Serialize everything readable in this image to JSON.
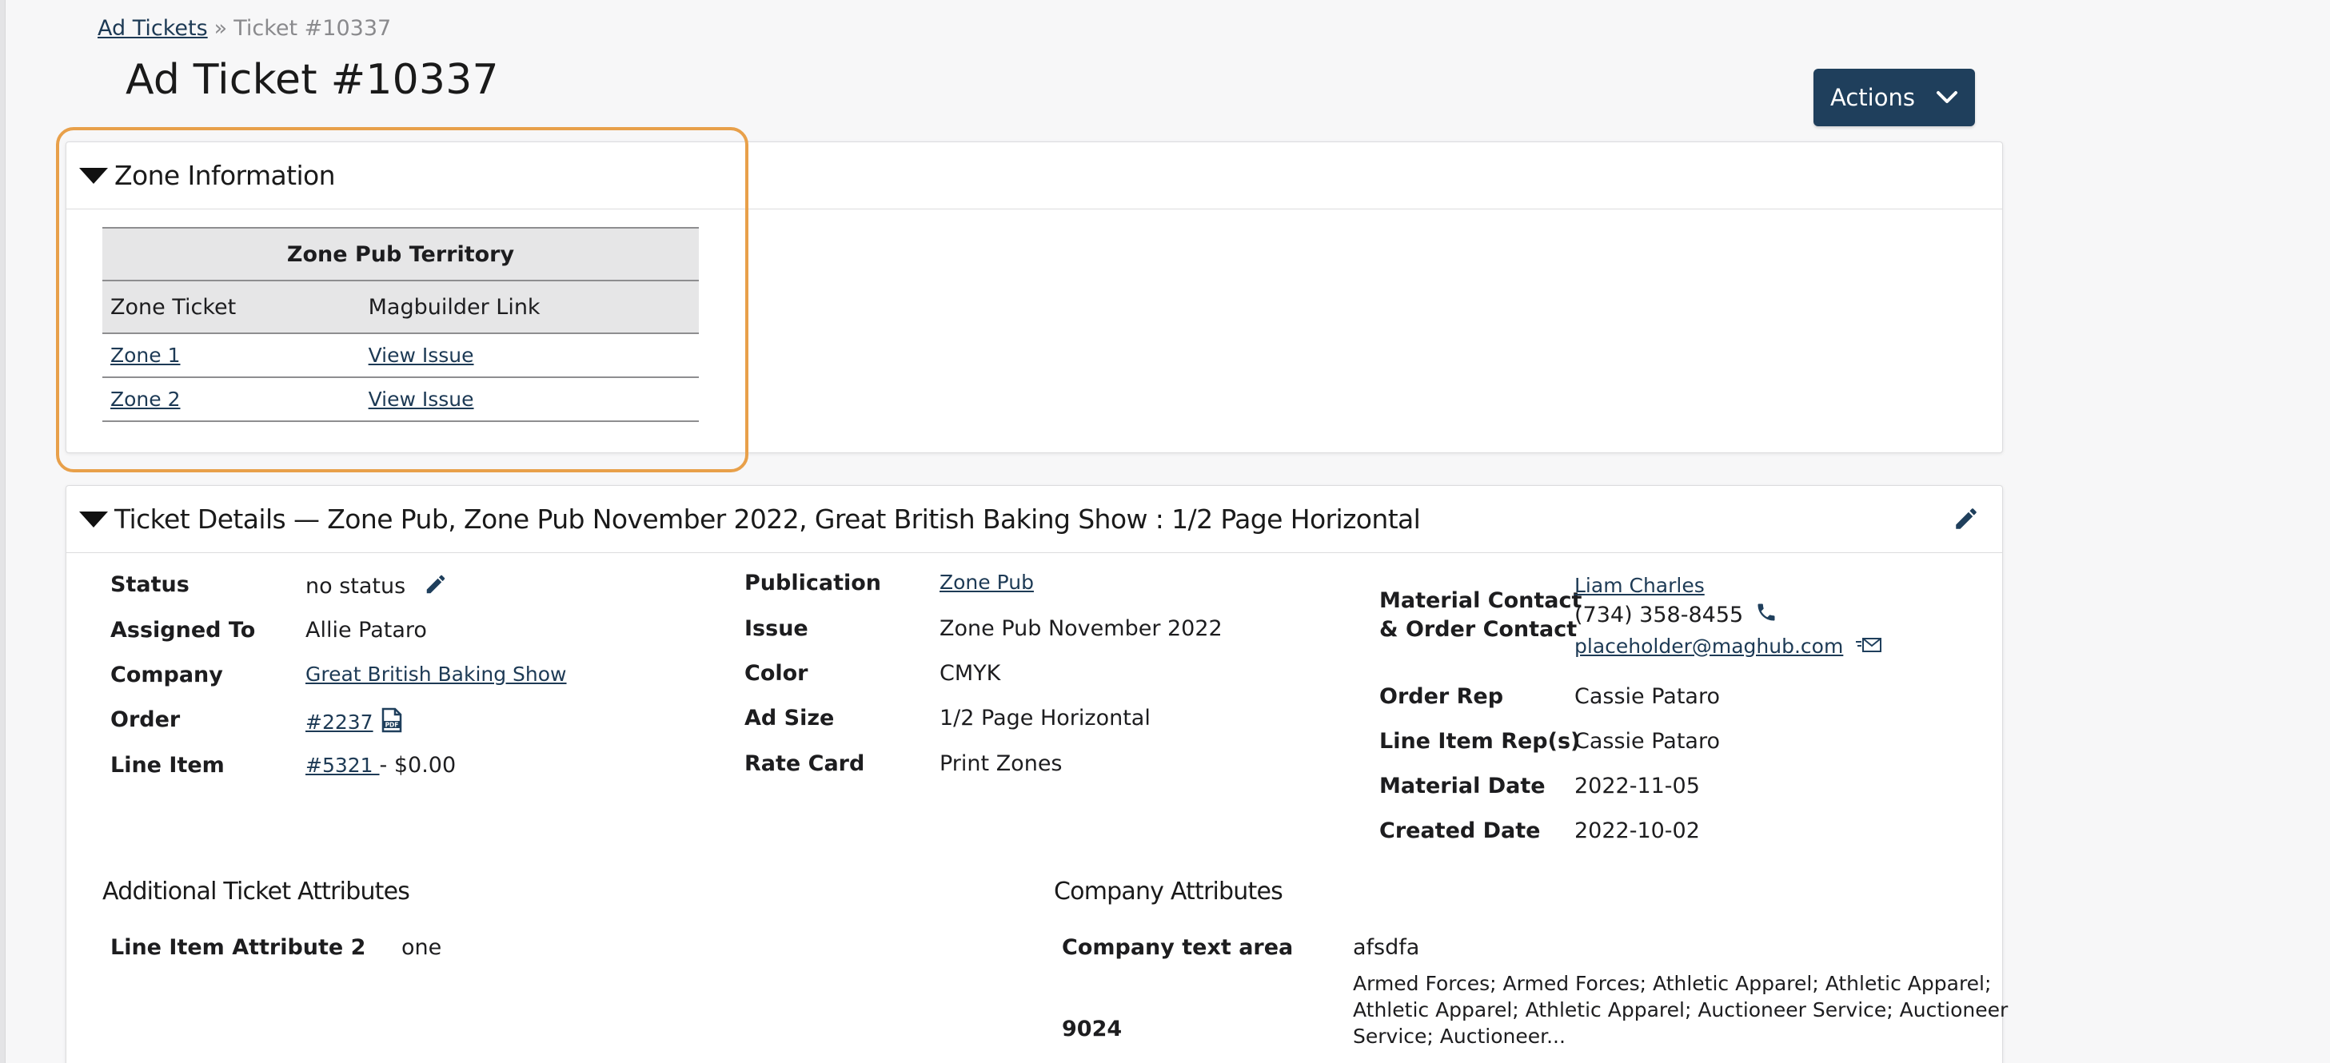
{
  "breadcrumb": {
    "root": "Ad Tickets",
    "separator": "»",
    "current": "Ticket #10337"
  },
  "page_title": "Ad Ticket #10337",
  "actions_label": "Actions",
  "zone_panel": {
    "title": "Zone Information",
    "table_title": "Zone Pub Territory",
    "columns": [
      "Zone Ticket",
      "Magbuilder Link"
    ],
    "rows": [
      {
        "zone": "Zone 1",
        "link": "View Issue"
      },
      {
        "zone": "Zone 2",
        "link": "View Issue"
      }
    ]
  },
  "details_panel": {
    "title": "Ticket Details — Zone Pub, Zone Pub November 2022, Great British Baking Show : 1/2 Page Horizontal",
    "col1": {
      "status_label": "Status",
      "status_value": "no status",
      "assigned_label": "Assigned To",
      "assigned_value": "Allie Pataro",
      "company_label": "Company",
      "company_value": "Great British Baking Show",
      "order_label": "Order",
      "order_value": "#2237",
      "line_item_label": "Line Item",
      "line_item_link": "#5321 ",
      "line_item_amount": "- $0.00"
    },
    "col2": {
      "publication_label": "Publication",
      "publication_value": "Zone Pub",
      "issue_label": "Issue",
      "issue_value": "Zone Pub November 2022",
      "color_label": "Color",
      "color_value": "CMYK",
      "adsize_label": "Ad Size",
      "adsize_value": "1/2 Page Horizontal",
      "ratecard_label": "Rate Card",
      "ratecard_value": "Print Zones"
    },
    "col3": {
      "contact_label_1": "Material Contact",
      "contact_label_2": "& Order Contact",
      "contact_name": "Liam Charles",
      "contact_phone": "(734) 358-8455",
      "contact_email": "placeholder@maghub.com",
      "order_rep_label": "Order Rep",
      "order_rep_value": "Cassie Pataro",
      "line_rep_label": "Line Item Rep(s)",
      "line_rep_value": "Cassie Pataro",
      "material_date_label": "Material Date",
      "material_date_value": "2022-11-05",
      "created_date_label": "Created Date",
      "created_date_value": "2022-10-02"
    },
    "additional": {
      "title": "Additional Ticket Attributes",
      "attr_label": "Line Item Attribute 2",
      "attr_value": "one"
    },
    "company_attrs": {
      "title": "Company Attributes",
      "text_area_label": "Company text area",
      "text_area_value": "afsdfa",
      "code_label": "9024",
      "code_value_1": "Armed Forces; Armed Forces; Athletic Apparel; Athletic Apparel;",
      "code_value_2": "Athletic Apparel; Athletic Apparel; Auctioneer Service; Auctioneer",
      "code_value_3": "Service; Auctioneer..."
    }
  },
  "colors": {
    "primary": "#1f3f5c",
    "highlight": "#e8a04a",
    "link": "#1d3a55"
  },
  "icons": [
    "chevron-down-icon",
    "caret-down-icon",
    "pencil-icon",
    "pdf-icon",
    "phone-icon",
    "email-icon"
  ]
}
